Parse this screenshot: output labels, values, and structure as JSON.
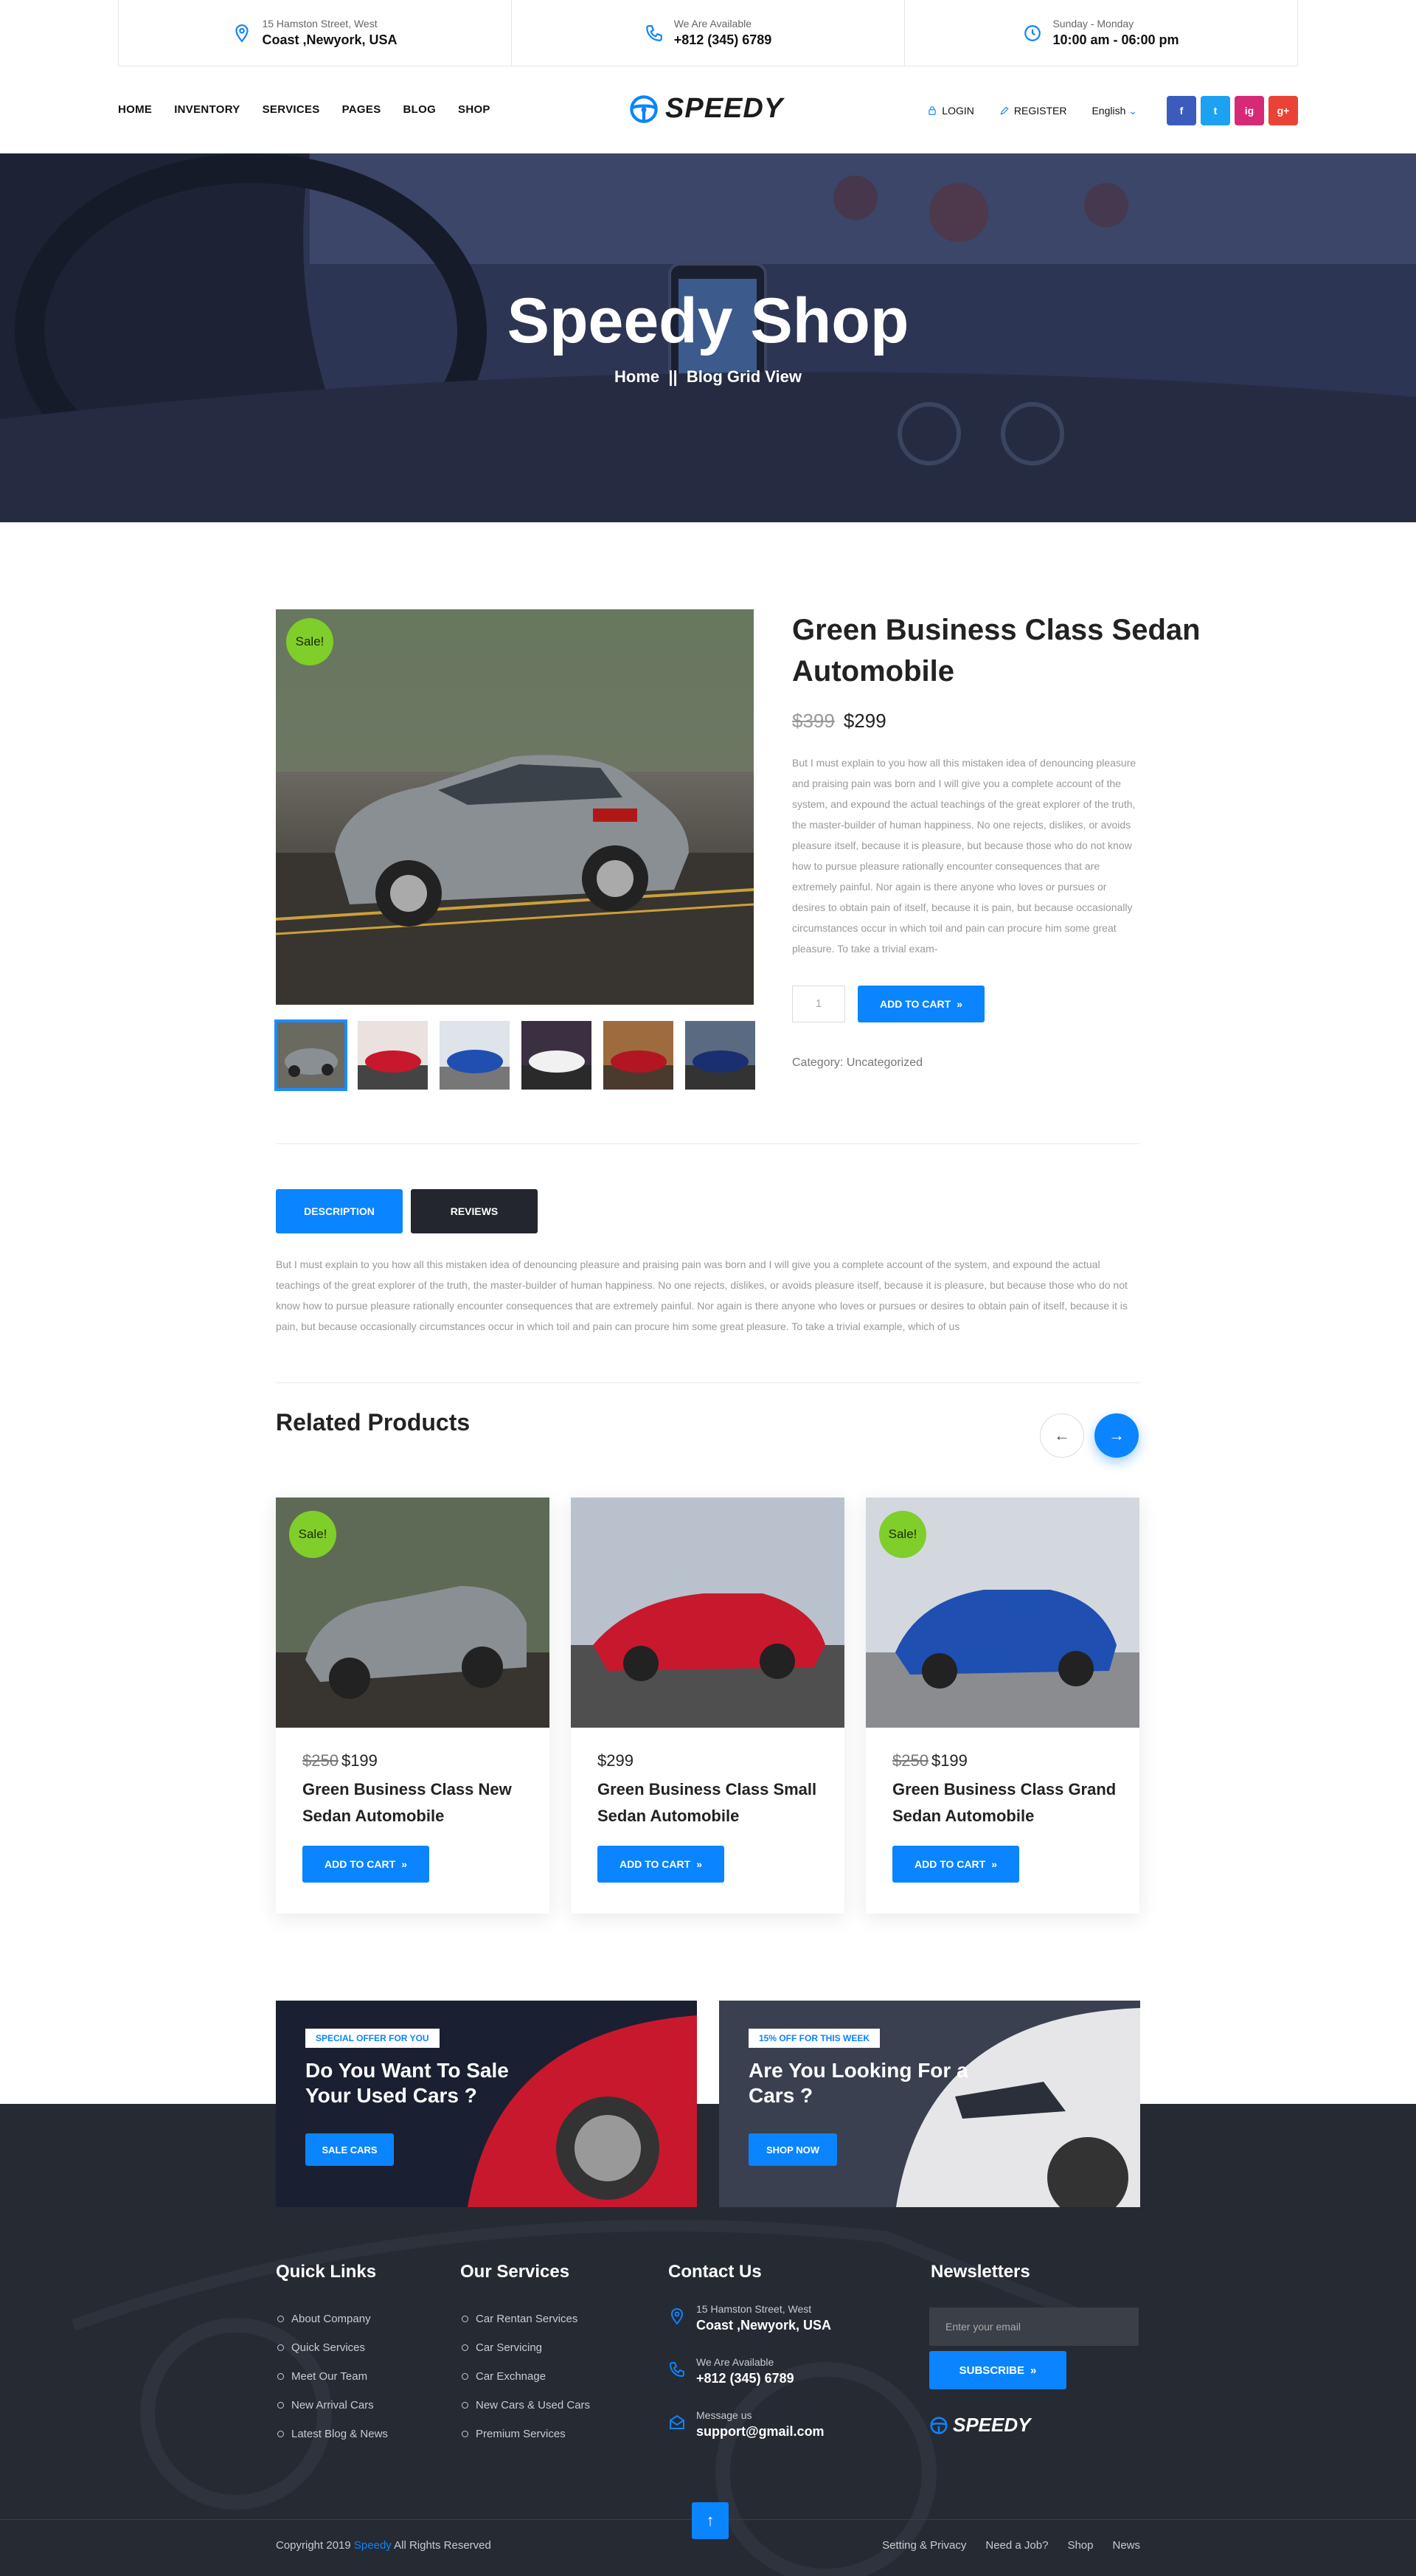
{
  "topbar": {
    "address": {
      "small": "15 Hamston Street, West",
      "big": "Coast ,Newyork, USA"
    },
    "phone": {
      "small": "We Are Available",
      "big": "+812 (345) 6789"
    },
    "hours": {
      "small": "Sunday - Monday",
      "big": "10:00 am - 06:00 pm"
    }
  },
  "nav": {
    "items": [
      "HOME",
      "INVENTORY",
      "SERVICES",
      "PAGES",
      "BLOG",
      "SHOP"
    ],
    "logo": "SPEEDY",
    "login": "LOGIN",
    "register": "REGISTER",
    "language": "English",
    "social": [
      "f",
      "t",
      "ig",
      "g+"
    ]
  },
  "hero": {
    "title": "Speedy Shop",
    "breadcrumb_home": "Home",
    "breadcrumb_sep": "||",
    "breadcrumb_current": "Blog Grid View"
  },
  "product": {
    "sale_badge": "Sale!",
    "title": "Green Business Class Sedan Automobile",
    "old_price": "$399",
    "price": "$299",
    "description": "But I must explain to you how all this mistaken idea of denouncing pleasure and praising pain was born and I will give you a complete account of the system, and expound the actual teachings of the great explorer of the truth, the master-builder of human happiness. No one rejects, dislikes, or avoids pleasure itself, because it is pleasure, but because those who do not know how to pursue pleasure rationally encounter consequences that are extremely painful. Nor again is there anyone who loves or pursues or desires to obtain pain of itself, because it is pain, but because occasionally circumstances occur in which toil and pain can procure him some great pleasure. To take a trivial exam-",
    "quantity": "1",
    "add_to_cart": "ADD TO CART",
    "category_label": "Category:",
    "category": "Uncategorized"
  },
  "tabs": {
    "description": "DESCRIPTION",
    "reviews": "REVIEWS",
    "content": "But I must explain to you how all this mistaken idea of denouncing pleasure and praising pain was born and I will give you a complete account of the system, and expound the actual teachings of the great explorer  of the truth, the master-builder of human happiness. No one rejects, dislikes, or avoids pleasure itself, because it is pleasure, but because those who do not know how to pursue pleasure rationally encounter consequences that are extremely painful. Nor again is there anyone who loves or pursues or desires to obtain pain of itself, because it is pain, but because occasionally circumstances occur in which toil and pain can procure him some great pleasure. To take a trivial example, which of us"
  },
  "related": {
    "title": "Related Products",
    "items": [
      {
        "sale": "Sale!",
        "old_price": "$250",
        "price": "$199",
        "title": "Green Business Class New Sedan Automobile",
        "button": "ADD TO CART"
      },
      {
        "sale": "",
        "old_price": "",
        "price": "$299",
        "title": "Green Business Class Small Sedan Automobile",
        "button": "ADD TO CART"
      },
      {
        "sale": "Sale!",
        "old_price": "$250",
        "price": "$199",
        "title": "Green Business Class Grand Sedan Automobile",
        "button": "ADD TO CART"
      }
    ]
  },
  "banners": [
    {
      "tag": "SPECIAL OFFER FOR YOU",
      "title": "Do You Want To Sale Your Used Cars ?",
      "button": "SALE CARS"
    },
    {
      "tag": "15% OFF FOR THIS WEEK",
      "title": "Are You Looking For a Cars ?",
      "button": "SHOP NOW"
    }
  ],
  "footer": {
    "quick_links": {
      "title": "Quick Links",
      "items": [
        "About Company",
        "Quick Services",
        "Meet Our Team",
        "New Arrival Cars",
        "Latest Blog & News"
      ]
    },
    "services": {
      "title": "Our Services",
      "items": [
        "Car Rentan Services",
        "Car Servicing",
        "Car Exchnage",
        "New Cars & Used Cars",
        "Premium Services"
      ]
    },
    "contact": {
      "title": "Contact Us",
      "address_small": "15 Hamston Street, West",
      "address_big": "Coast ,Newyork, USA",
      "phone_small": "We Are Available",
      "phone_big": "+812 (345) 6789",
      "mail_small": "Message us",
      "mail_big": "support@gmail.com"
    },
    "newsletter": {
      "title": "Newsletters",
      "placeholder": "Enter your email",
      "button": "SUBSCRIBE"
    },
    "logo": "SPEEDY",
    "copyright_pre": "Copyright  2019",
    "copyright_brand": "Speedy",
    "copyright_post": "All Rights Reserved",
    "bottom_links": [
      "Setting & Privacy",
      "Need a Job?",
      "Shop",
      "News"
    ]
  },
  "colors": {
    "accent": "#0b84ff",
    "sale": "#7fce2a",
    "dark": "#262a33"
  }
}
